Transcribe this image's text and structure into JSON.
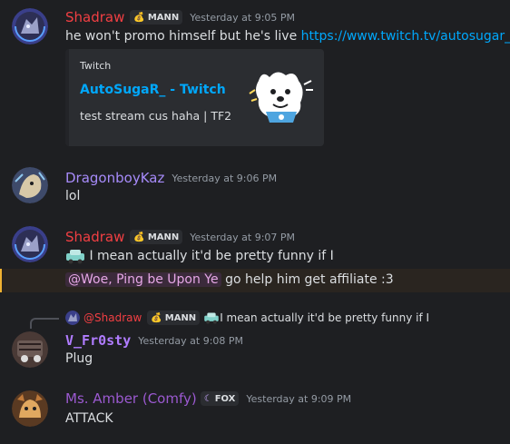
{
  "messages": [
    {
      "username": "Shadraw",
      "username_color": "#f23f43",
      "tag": "MANN",
      "tag_icon": "money-bag-icon",
      "timestamp": "Yesterday at 9:05 PM",
      "text_prefix": "he won't promo himself but he's live ",
      "link": "https://www.twitch.tv/autosugar_",
      "embed": {
        "provider": "Twitch",
        "title": "AutoSugaR_ - Twitch",
        "description": "test stream cus haha | TF2"
      }
    },
    {
      "username": "DragonboyKaz",
      "username_color": "#a78bfa",
      "timestamp": "Yesterday at 9:06 PM",
      "text": "lol"
    },
    {
      "username": "Shadraw",
      "username_color": "#f23f43",
      "tag": "MANN",
      "timestamp": "Yesterday at 9:07 PM",
      "text": " I mean actually it'd be pretty funny if I",
      "mention": "@Woe, Ping be Upon Ye",
      "text2": " go help him get affiliate :3"
    },
    {
      "reply": {
        "username": "@Shadraw",
        "tag": "MANN",
        "text": " I mean actually it'd be pretty funny if I"
      },
      "username": "V_Fr0sty",
      "username_color": "#b07cff",
      "timestamp": "Yesterday at 9:08 PM",
      "text": "Plug"
    },
    {
      "username": "Ms. Amber (Comfy)",
      "username_color": "#9b59d0",
      "tag": "FOX",
      "tag_icon": "moon-icon",
      "timestamp": "Yesterday at 9:09 PM",
      "text": "ATTACK"
    }
  ]
}
